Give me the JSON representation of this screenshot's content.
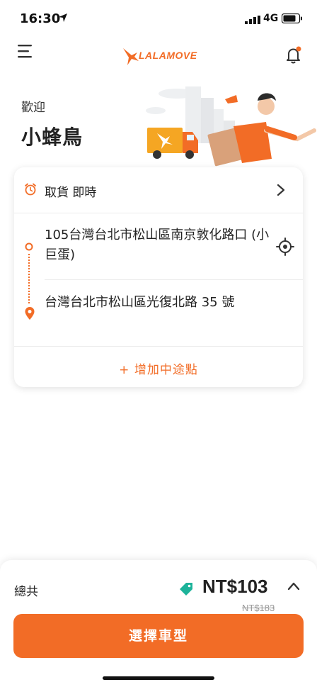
{
  "status_bar": {
    "time": "16:30",
    "network": "4G"
  },
  "header": {
    "logo_text": "LALAMOVE"
  },
  "greeting": {
    "welcome": "歡迎",
    "name": "小蜂鳥"
  },
  "order_card": {
    "pickup_time": "取貨 即時",
    "pickup_address": "105台灣台北市松山區南京敦化路口 (小巨蛋)",
    "dropoff_address": "台灣台北市松山區光復北路 35 號",
    "add_stop": "+ 增加中途點"
  },
  "summary": {
    "total_label": "總共",
    "price": "NT$103",
    "original_price": "NT$183",
    "cta": "選擇車型"
  },
  "colors": {
    "brand": "#f26c26",
    "tag": "#1db39a"
  }
}
